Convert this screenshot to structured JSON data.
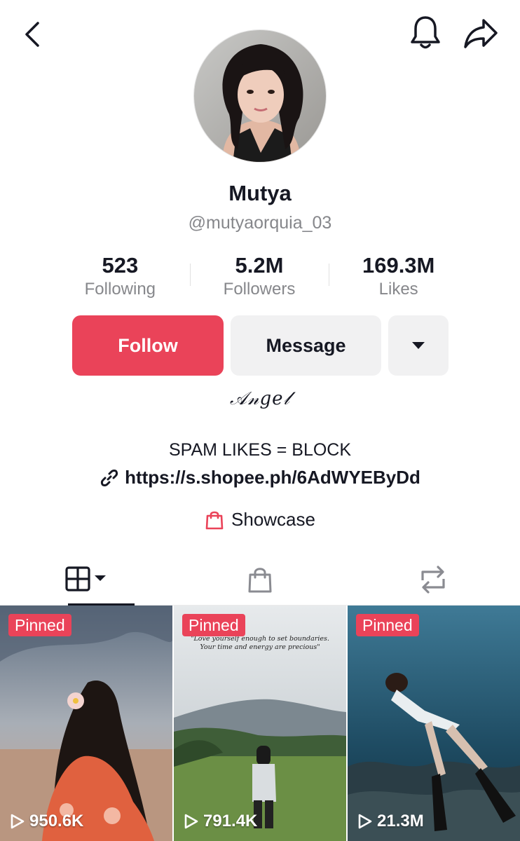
{
  "header": {
    "back_icon": "chevron-left-icon",
    "bell_icon": "bell-icon",
    "share_icon": "share-arrow-icon"
  },
  "profile": {
    "name": "Mutya",
    "handle": "@mutyaorquia_03",
    "stats": [
      {
        "value": "523",
        "label": "Following"
      },
      {
        "value": "5.2M",
        "label": "Followers"
      },
      {
        "value": "169.3M",
        "label": "Likes"
      }
    ],
    "nickname_art": "𝒜𝓃𝑔𝑒𝓁",
    "bio": "SPAM LIKES = BLOCK",
    "link": "https://s.shopee.ph/6AdWYEByDd",
    "showcase": "Showcase"
  },
  "actions": {
    "follow": "Follow",
    "message": "Message",
    "more_icon": "caret-down-icon"
  },
  "tabs": [
    {
      "icon": "grid-icon",
      "active": true
    },
    {
      "icon": "shopping-bag-icon",
      "active": false
    },
    {
      "icon": "repost-icon",
      "active": false
    }
  ],
  "videos": [
    {
      "badge": "Pinned",
      "views": "950.6K"
    },
    {
      "badge": "Pinned",
      "views": "791.4K",
      "quote": "\"Love yourself enough to set boundaries. Your time and energy are precious\""
    },
    {
      "badge": "Pinned",
      "views": "21.3M"
    }
  ],
  "colors": {
    "accent": "#ea4359",
    "secondary_button": "#f1f1f2",
    "muted_text": "#86878b"
  }
}
